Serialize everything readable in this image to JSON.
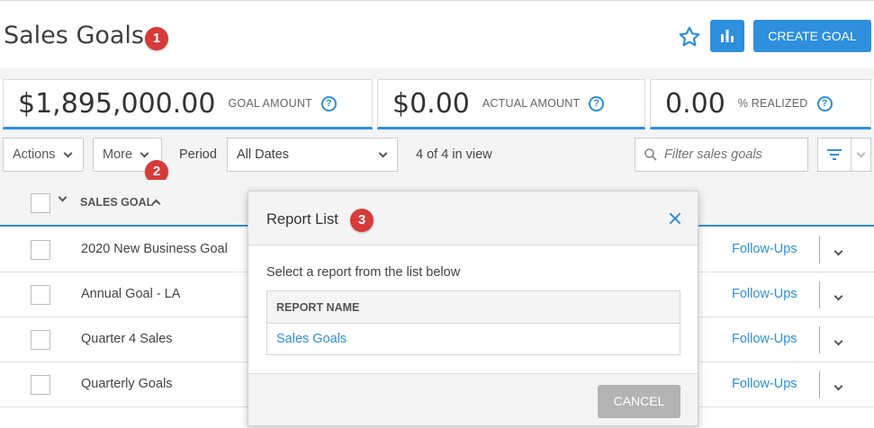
{
  "header": {
    "title": "Sales Goals",
    "create_label": "CREATE GOAL",
    "badges": [
      "1",
      "2",
      "3"
    ]
  },
  "kpis": [
    {
      "value": "$1,895,000.00",
      "label": "GOAL AMOUNT",
      "help": "?"
    },
    {
      "value": "$0.00",
      "label": "ACTUAL AMOUNT",
      "help": "?"
    },
    {
      "value": "0.00",
      "label": "% REALIZED",
      "help": "?"
    }
  ],
  "toolbar": {
    "actions_label": "Actions",
    "more_label": "More",
    "period_label": "Period",
    "period_value": "All Dates",
    "view_count": "4 of 4 in view",
    "filter_placeholder": "Filter sales goals"
  },
  "table": {
    "column_header": "SALES GOAL",
    "rows": [
      {
        "name": "2020 New Business Goal",
        "link": "Follow-Ups"
      },
      {
        "name": "Annual Goal - LA",
        "link": "Follow-Ups"
      },
      {
        "name": "Quarter 4 Sales",
        "link": "Follow-Ups"
      },
      {
        "name": "Quarterly Goals",
        "link": "Follow-Ups"
      }
    ]
  },
  "modal": {
    "title": "Report List",
    "description": "Select a report from the list below",
    "column_header": "REPORT NAME",
    "reports": [
      "Sales Goals"
    ],
    "cancel_label": "CANCEL"
  },
  "colors": {
    "accent": "#2d8fdd",
    "badge": "#d83a3a",
    "panel_bg": "#f4f4f4",
    "cancel_bg": "#b3b3b3"
  },
  "icons": [
    "star-icon",
    "bar-chart-icon",
    "help-icon",
    "chevron-down-icon",
    "search-icon",
    "filter-icon",
    "sort-up-icon",
    "close-icon"
  ]
}
